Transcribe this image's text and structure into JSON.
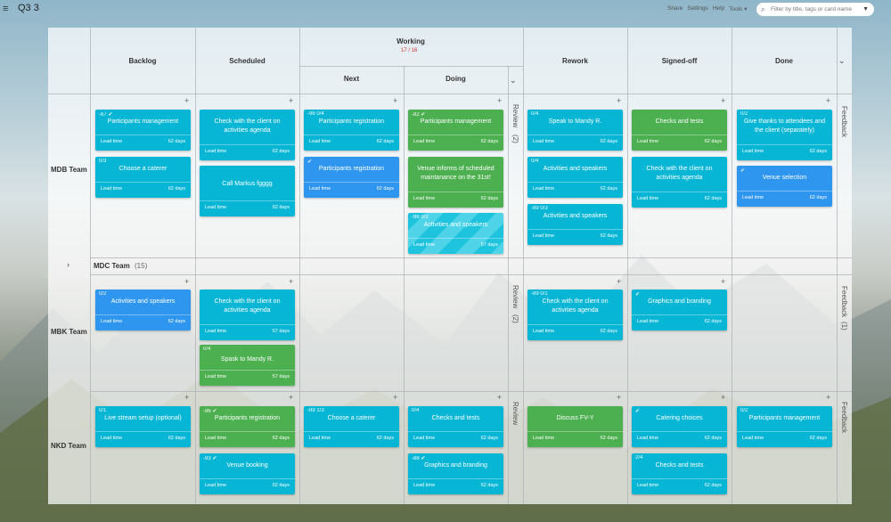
{
  "app": {
    "title": "Q3 3",
    "menu_icon": "hamburger-icon",
    "links": [
      "Share",
      "Settings",
      "Help",
      "Tools ▾"
    ],
    "filter_placeholder": "Filter by title, tags or card name"
  },
  "columns": {
    "backlog": "Backlog",
    "scheduled": "Scheduled",
    "working": "Working",
    "working_wip": "17 / 16",
    "next": "Next",
    "doing": "Doing",
    "rework": "Rework",
    "signed_off": "Signed-off",
    "done": "Done"
  },
  "side": {
    "review": "Review",
    "review_count": "(2)",
    "feedback": "Feedback",
    "feedback_count": "(1)"
  },
  "lanes": {
    "mdb": "MDB Team",
    "mdc": "MDC Team",
    "mdc_count": "(15)",
    "mbk": "MBK Team",
    "nkd": "NKD Team"
  },
  "lead_time_label": "Lead time",
  "colors": {
    "cyan": "#06b6d4",
    "green": "#4caf50",
    "blue": "#2f96f0"
  },
  "cards": [
    {
      "meta": "-67 ✔",
      "title": "Participants management",
      "days": "62 days"
    },
    {
      "meta": "0/3",
      "title": "Choose a caterer",
      "days": "62 days"
    },
    {
      "meta": "",
      "title": "Check with the client on activities agenda",
      "days": "62 days"
    },
    {
      "meta": "",
      "title": "Call Markus fgggg",
      "days": "62 days"
    },
    {
      "meta": "-96 0/4",
      "title": "Participants registration",
      "days": "62 days"
    },
    {
      "meta": "✔",
      "title": "Participants registration",
      "days": "62 days"
    },
    {
      "meta": "-82 ✔",
      "title": "Participants management",
      "days": "62 days"
    },
    {
      "meta": "",
      "title": "Venue informs of scheduled maintanance on the 31st!",
      "days": "62 days"
    },
    {
      "meta": "-96 0/2",
      "title": "Activities and speakers",
      "days": "57 days"
    },
    {
      "meta": "0/4",
      "title": "Speak to Mandy R.",
      "days": "62 days"
    },
    {
      "meta": "0/4",
      "title": "Activities and speakers",
      "days": "62 days"
    },
    {
      "meta": "-89 0/3",
      "title": "Activities and speakers",
      "days": "62 days"
    },
    {
      "meta": "",
      "title": "Checks and tests",
      "days": "62 days"
    },
    {
      "meta": "",
      "title": "Check with the client on activities agenda",
      "days": "62 days"
    },
    {
      "meta": "0/2",
      "title": "Give thanks to attendees and the client (separately)",
      "days": "62 days"
    },
    {
      "meta": "✔",
      "title": "Venue selection",
      "days": "62 days"
    },
    {
      "meta": "0/2",
      "title": "Activities and speakers",
      "days": "62 days"
    },
    {
      "meta": "",
      "title": "Check with the client on activities agenda",
      "days": "57 days"
    },
    {
      "meta": "0/4",
      "title": "Spask to Mandy R.",
      "days": "57 days"
    },
    {
      "meta": "-89 0/1",
      "title": "Check with the client on activities agenda",
      "days": "62 days"
    },
    {
      "meta": "✔",
      "title": "Graphics and branding",
      "days": "62 days"
    },
    {
      "meta": "0/1",
      "title": "Live stream setup (optional)",
      "days": "62 days"
    },
    {
      "meta": "-96 ✔",
      "title": "Participants registration",
      "days": "62 days"
    },
    {
      "meta": "-93 ✔",
      "title": "Venue booking",
      "days": "62 days"
    },
    {
      "meta": "-89 1/3",
      "title": "Choose a caterer",
      "days": "62 days"
    },
    {
      "meta": "0/4",
      "title": "Checks and tests",
      "days": "62 days"
    },
    {
      "meta": "-88 ✔",
      "title": "Graphics and branding",
      "days": "62 days"
    },
    {
      "meta": "",
      "title": "Discuss FV-Y",
      "days": "62 days"
    },
    {
      "meta": "✔",
      "title": "Catering choices",
      "days": "62 days"
    },
    {
      "meta": "2/4",
      "title": "Checks and tests",
      "days": "62 days"
    },
    {
      "meta": "0/2",
      "title": "Participants management",
      "days": "62 days"
    }
  ]
}
